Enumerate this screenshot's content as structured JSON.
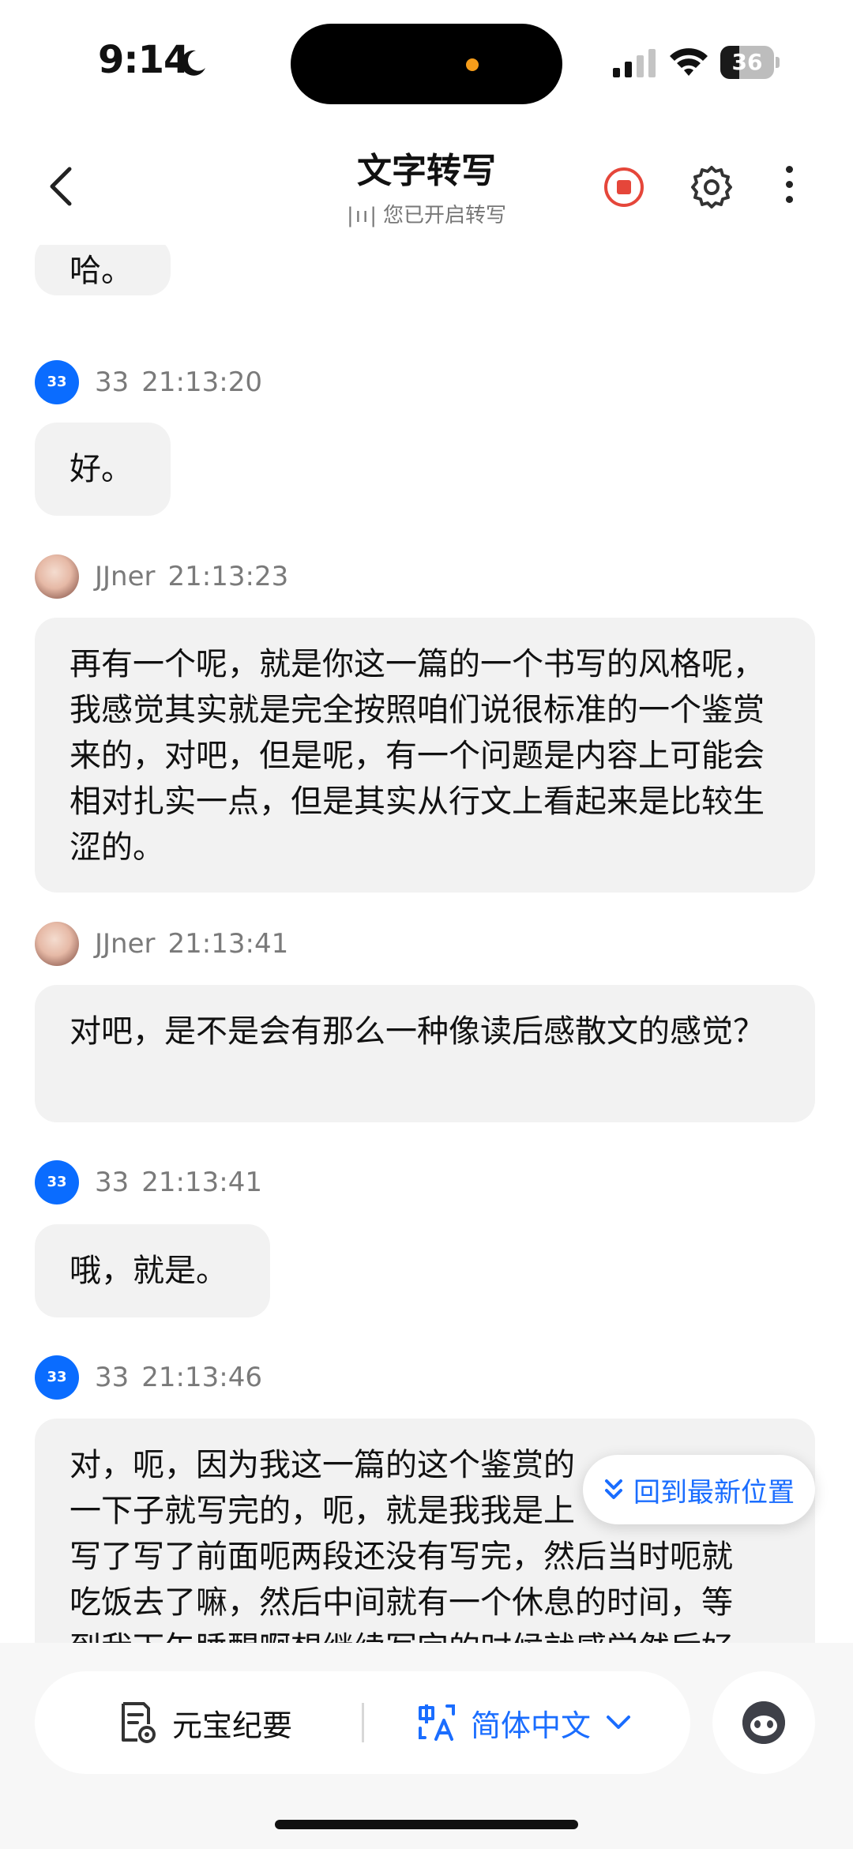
{
  "status_bar": {
    "time": "9:14",
    "battery": "36",
    "battery_level": 0.36
  },
  "header": {
    "title": "文字转写",
    "subtitle": "您已开启转写",
    "subtitle_icon": "waveform-icon"
  },
  "messages": [
    {
      "speaker": "",
      "time": "",
      "text": "哈。"
    },
    {
      "speaker": "33",
      "time": "21:13:20",
      "avatar": "33",
      "text": "好。"
    },
    {
      "speaker": "JJner",
      "time": "21:13:23",
      "avatar": "photo",
      "text": "再有一个呢，就是你这一篇的一个书写的风格呢，我感觉其实就是完全按照咱们说很标准的一个鉴赏来的，对吧，但是呢，有一个问题是内容上可能会相对扎实一点，但是其实从行文上看起来是比较生涩的。"
    },
    {
      "speaker": "JJner",
      "time": "21:13:41",
      "avatar": "photo",
      "text": "对吧，是不是会有那么一种像读后感散文的感觉？"
    },
    {
      "speaker": "33",
      "time": "21:13:41",
      "avatar": "33",
      "text": "哦，就是。"
    },
    {
      "speaker": "33",
      "time": "21:13:46",
      "avatar": "33",
      "text": "对，呃，因为我这一篇的这个鉴赏的",
      "text_lines": [
        "对，呃，因为我这一篇的这个鉴赏的",
        "一下子就写完的，呃，就是我我是上",
        "写了写了前面呃两段还没有写完，然后当时呃就",
        "吃饭去了嘛，然后中间就有一个休息的时间，等",
        "到我下午睡醒啊想继续写完的时候就感觉然后好"
      ]
    }
  ],
  "jump_button": {
    "label": "回到最新位置"
  },
  "toolbar": {
    "summary_label": "元宝纪要",
    "language_label": "简体中文"
  },
  "colors": {
    "accent": "#1a6dff",
    "record": "#e5463a",
    "bubble": "#f2f2f2",
    "avatar_33": "#0a6cff"
  }
}
